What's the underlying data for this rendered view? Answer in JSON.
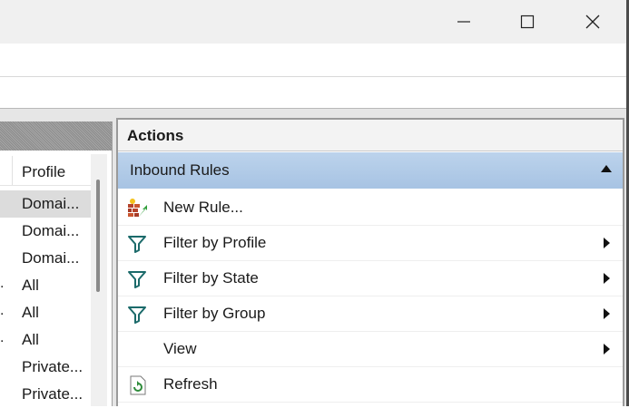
{
  "window": {
    "controls": {
      "minimize": "minimize-icon",
      "maximize": "maximize-icon",
      "close": "close-icon"
    }
  },
  "list": {
    "column_header": "Profile",
    "rows": [
      {
        "prefix": "",
        "profile": "Domai...",
        "selected": true
      },
      {
        "prefix": "",
        "profile": "Domai...",
        "selected": false
      },
      {
        "prefix": "",
        "profile": "Domai...",
        "selected": false
      },
      {
        "prefix": ".",
        "profile": "All",
        "selected": false
      },
      {
        "prefix": ".",
        "profile": "All",
        "selected": false
      },
      {
        "prefix": ".",
        "profile": "All",
        "selected": false
      },
      {
        "prefix": "",
        "profile": "Private...",
        "selected": false
      },
      {
        "prefix": "",
        "profile": "Private...",
        "selected": false
      }
    ]
  },
  "actions": {
    "title": "Actions",
    "section": "Inbound Rules",
    "items": [
      {
        "label": "New Rule...",
        "icon": "new-rule-icon",
        "submenu": false
      },
      {
        "label": "Filter by Profile",
        "icon": "filter-icon",
        "submenu": true
      },
      {
        "label": "Filter by State",
        "icon": "filter-icon",
        "submenu": true
      },
      {
        "label": "Filter by Group",
        "icon": "filter-icon",
        "submenu": true
      },
      {
        "label": "View",
        "icon": "",
        "submenu": true
      },
      {
        "label": "Refresh",
        "icon": "refresh-icon",
        "submenu": false
      }
    ]
  },
  "colors": {
    "section_header": "#b3cce8",
    "selected_row": "#dcdcdc",
    "filter_icon": "#1b6a6a"
  }
}
